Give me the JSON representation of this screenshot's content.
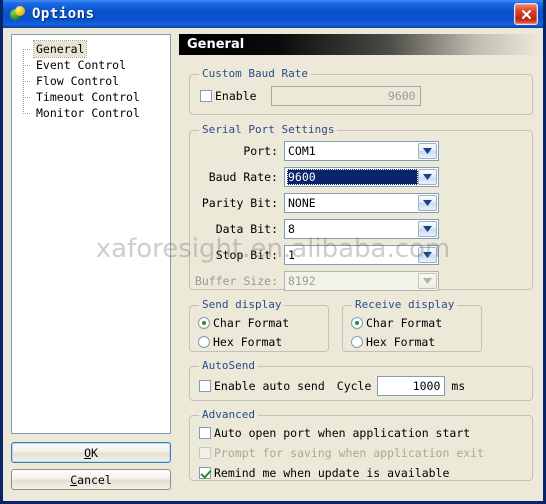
{
  "window": {
    "title": "Options",
    "icon": "options-gear-icon",
    "close_label": "×",
    "accent_title_color": "#0A53CE",
    "face_color": "#ECE9D8",
    "border_color": "#0A246A"
  },
  "watermark": {
    "text": "xaforesight.en.alibaba.com"
  },
  "sidebar": {
    "items": [
      {
        "label": "General",
        "selected": true
      },
      {
        "label": "Event Control",
        "selected": false
      },
      {
        "label": "Flow Control",
        "selected": false
      },
      {
        "label": "Timeout Control",
        "selected": false
      },
      {
        "label": "Monitor Control",
        "selected": false
      }
    ]
  },
  "buttons": {
    "ok": {
      "prefix": "O",
      "rest": "K",
      "focused": true
    },
    "cancel": {
      "prefix": "C",
      "rest": "ancel",
      "focused": false
    }
  },
  "page": {
    "header": "General"
  },
  "custom_baud_rate": {
    "title": "Custom Baud Rate",
    "enable_label": "Enable",
    "enable_checked": false,
    "value": "9600",
    "value_disabled": true
  },
  "serial_port_settings": {
    "title": "Serial Port Settings",
    "fields": [
      {
        "label": "Port:",
        "value": "COM1",
        "disabled": false,
        "focused": false
      },
      {
        "label": "Baud Rate:",
        "value": "9600",
        "disabled": false,
        "focused": true
      },
      {
        "label": "Parity Bit:",
        "value": "NONE",
        "disabled": false,
        "focused": false
      },
      {
        "label": "Data Bit:",
        "value": "8",
        "disabled": false,
        "focused": false
      },
      {
        "label": "Stop Bit:",
        "value": "1",
        "disabled": false,
        "focused": false
      },
      {
        "label": "Buffer Size:",
        "value": "8192",
        "disabled": true,
        "focused": false
      }
    ]
  },
  "send_display": {
    "title": "Send display",
    "options": [
      {
        "label": "Char Format",
        "selected": true
      },
      {
        "label": "Hex  Format",
        "selected": false
      }
    ]
  },
  "receive_display": {
    "title": "Receive display",
    "options": [
      {
        "label": "Char Format",
        "selected": true
      },
      {
        "label": "Hex  Format",
        "selected": false
      }
    ]
  },
  "auto_send": {
    "title": "AutoSend",
    "enable_label": "Enable auto send",
    "enable_checked": false,
    "cycle_label": "Cycle",
    "cycle_value": "1000",
    "unit_label": "ms"
  },
  "advanced": {
    "title": "Advanced",
    "options": [
      {
        "label": "Auto open port when application start",
        "checked": false,
        "disabled": false
      },
      {
        "label": "Prompt for saving when application exit",
        "checked": false,
        "disabled": true
      },
      {
        "label": "Remind me when update is available",
        "checked": true,
        "disabled": false
      }
    ]
  }
}
